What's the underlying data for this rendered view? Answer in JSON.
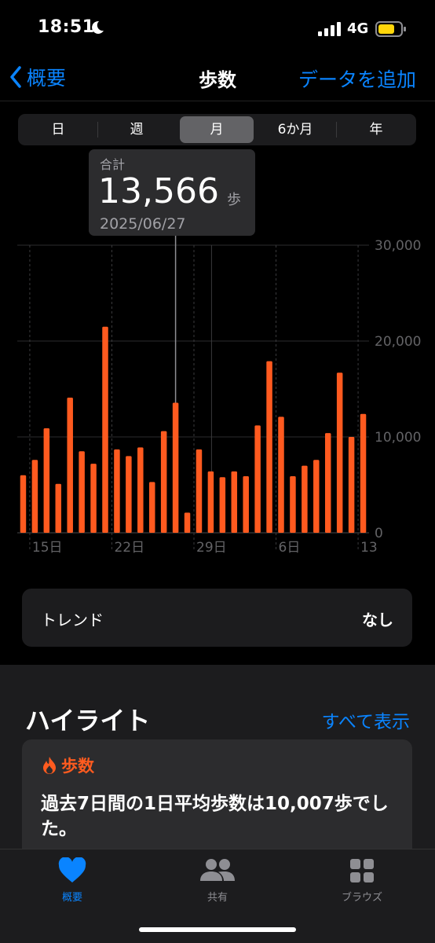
{
  "status": {
    "time": "18:51",
    "network": "4G"
  },
  "nav": {
    "back_label": "概要",
    "title": "歩数",
    "add_label": "データを追加"
  },
  "segments": [
    "日",
    "週",
    "月",
    "6か月",
    "年"
  ],
  "active_segment": "月",
  "tooltip": {
    "label": "合計",
    "value": "13,566",
    "unit": "歩",
    "date": "2025/06/27"
  },
  "chart_data": {
    "type": "bar",
    "x": [
      "06/14",
      "06/15",
      "06/16",
      "06/17",
      "06/18",
      "06/19",
      "06/20",
      "06/21",
      "06/22",
      "06/23",
      "06/24",
      "06/25",
      "06/26",
      "06/27",
      "06/28",
      "06/29",
      "06/30",
      "07/01",
      "07/02",
      "07/03",
      "07/04",
      "07/05",
      "07/06",
      "07/07",
      "07/08",
      "07/09",
      "07/10",
      "07/11",
      "07/12",
      "07/13"
    ],
    "values": [
      6000,
      7600,
      10900,
      5100,
      14100,
      8500,
      7200,
      21500,
      8700,
      8000,
      8900,
      5300,
      10600,
      13566,
      2100,
      8700,
      6400,
      5800,
      6400,
      5900,
      11200,
      17900,
      12100,
      5900,
      7000,
      7600,
      10400,
      16700,
      10000,
      12400
    ],
    "x_tick_labels": [
      "15日",
      "22日",
      "29日",
      "6日",
      "13"
    ],
    "y_ticks": [
      "30,000",
      "20,000",
      "10,000",
      "0"
    ],
    "ylim": [
      0,
      30000
    ],
    "grid": true,
    "selected": "06/27",
    "color": "#ff5a1f"
  },
  "trend": {
    "label": "トレンド",
    "value": "なし"
  },
  "highlights": {
    "title": "ハイライト",
    "show_all": "すべて表示",
    "card_category": "歩数",
    "card_body": "過去7日間の1日平均歩数は10,007歩でした。"
  },
  "tabs": [
    {
      "label": "概要",
      "icon": "heart-icon",
      "active": true
    },
    {
      "label": "共有",
      "icon": "people-icon",
      "active": false
    },
    {
      "label": "ブラウズ",
      "icon": "grid-icon",
      "active": false
    }
  ],
  "colors": {
    "accent": "#0a84ff",
    "bar": "#ff5a1f",
    "background": "#000000"
  }
}
